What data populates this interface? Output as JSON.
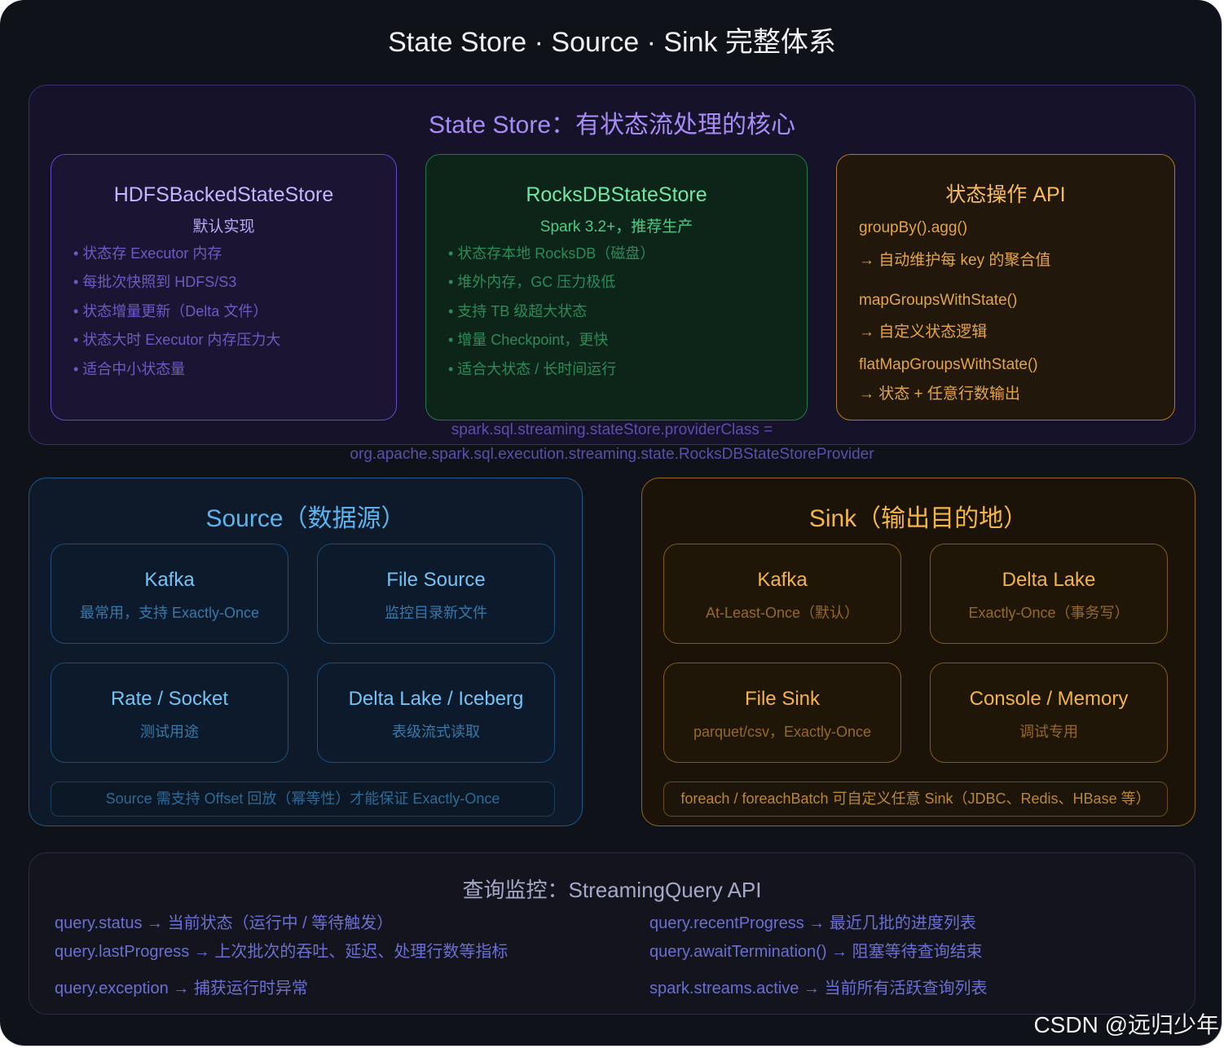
{
  "title": "State Store · Source · Sink 完整体系",
  "state_store": {
    "title": "State Store：有状态流处理的核心",
    "hdfs": {
      "title": "HDFSBackedStateStore",
      "subtitle": "默认实现",
      "items": [
        "• 状态存 Executor 内存",
        "• 每批次快照到 HDFS/S3",
        "• 状态增量更新（Delta 文件）",
        "• 状态大时 Executor 内存压力大",
        "• 适合中小状态量"
      ]
    },
    "rocksdb": {
      "title": "RocksDBStateStore",
      "subtitle": "Spark 3.2+，推荐生产",
      "items": [
        "• 状态存本地 RocksDB（磁盘）",
        "• 堆外内存，GC 压力极低",
        "• 支持 TB 级超大状态",
        "• 增量 Checkpoint，更快",
        "• 适合大状态 / 长时间运行"
      ]
    },
    "api": {
      "title": "状态操作 API",
      "items": [
        "groupBy().agg()",
        "→ 自动维护每 key 的聚合值",
        "mapGroupsWithState()",
        "→ 自定义状态逻辑",
        "flatMapGroupsWithState()",
        "→ 状态 + 任意行数输出"
      ]
    },
    "config": [
      "spark.sql.streaming.stateStore.providerClass =",
      "org.apache.spark.sql.execution.streaming.state.RocksDBStateStoreProvider"
    ]
  },
  "source": {
    "title": "Source（数据源）",
    "cards": [
      {
        "title": "Kafka",
        "subtitle": "最常用，支持 Exactly-Once"
      },
      {
        "title": "File Source",
        "subtitle": "监控目录新文件"
      },
      {
        "title": "Rate / Socket",
        "subtitle": "测试用途"
      },
      {
        "title": "Delta Lake / Iceberg",
        "subtitle": "表级流式读取"
      }
    ],
    "note": "Source 需支持 Offset 回放（幂等性）才能保证 Exactly-Once"
  },
  "sink": {
    "title": "Sink（输出目的地）",
    "cards": [
      {
        "title": "Kafka",
        "subtitle": "At-Least-Once（默认）"
      },
      {
        "title": "Delta Lake",
        "subtitle": "Exactly-Once（事务写）"
      },
      {
        "title": "File Sink",
        "subtitle": "parquet/csv，Exactly-Once"
      },
      {
        "title": "Console / Memory",
        "subtitle": "调试专用"
      }
    ],
    "note": "foreach / foreachBatch 可自定义任意 Sink（JDBC、Redis、HBase 等）"
  },
  "monitoring": {
    "title": "查询监控：StreamingQuery API",
    "left": [
      "query.status → 当前状态（运行中 / 等待触发）",
      "query.lastProgress → 上次批次的吞吐、延迟、处理行数等指标",
      "query.exception → 捕获运行时异常"
    ],
    "right": [
      "query.recentProgress → 最近几批的进度列表",
      "query.awaitTermination() → 阻塞等待查询结束",
      "spark.streams.active → 当前所有活跃查询列表"
    ]
  },
  "watermark": "CSDN @远归少年",
  "colors": {
    "background": "#10121a",
    "state_store_accent": "#a68cf4",
    "hdfs_accent": "#c5b5ff",
    "rocksdb_accent": "#72e6a4",
    "api_accent": "#f8bd63",
    "source_accent": "#5bb4ee",
    "sink_accent": "#f3b54a",
    "monitor_accent": "#6b6fd0"
  }
}
